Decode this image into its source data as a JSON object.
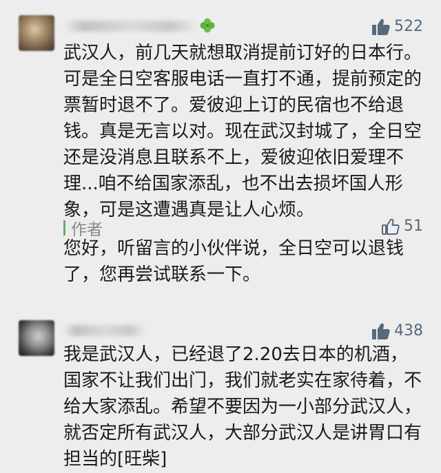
{
  "comments": [
    {
      "like_count": "522",
      "text": "武汉人，前几天就想取消提前订好的日本行。可是全日空客服电话一直打不通，提前预定的票暂时退不了。爱彼迎上订的民宿也不给退钱。真是无言以对。现在武汉封城了，全日空还是没消息且联系不上，爱彼迎依旧爱理不理...咱不给国家添乱，也不出去损坏国人形象，可是这遭遇真是让人心烦。"
    },
    {
      "like_count": "438",
      "text": "我是武汉人，已经退了2.20去日本的机酒，国家不让我们出门，我们就老实在家待着，不给大家添乱。希望不要因为一小部分武汉人，就否定所有武汉人，大部分武汉人是讲胃口有担当的[旺柴]"
    }
  ],
  "author_reply": {
    "label": "作者",
    "like_count": "51",
    "text": "您好，听留言的小伙伴说，全日空可以退钱了，您再尝试联系一下。"
  },
  "colors": {
    "like_filled": "#56697f",
    "author_accent": "#5ab45a",
    "background": "#ededed"
  },
  "icons": {
    "like_filled": "thumbs-up-filled-icon",
    "like_outline": "thumbs-up-outline-icon",
    "badge": "four-leaf-clover-icon"
  }
}
